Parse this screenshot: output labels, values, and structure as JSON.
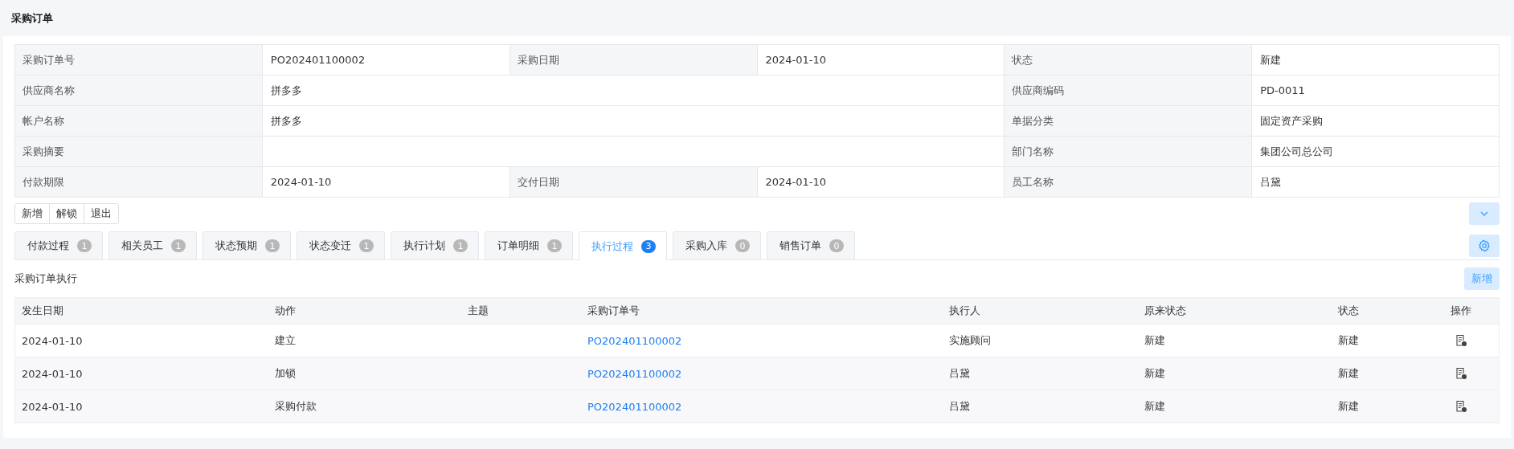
{
  "title": "采购订单",
  "info": {
    "rows": [
      {
        "kind": "triple",
        "cells": [
          {
            "label": "采购订单号",
            "value": "PO202401100002"
          },
          {
            "label": "采购日期",
            "value": "2024-01-10"
          },
          {
            "label": "状态",
            "value": "新建"
          }
        ]
      },
      {
        "kind": "double",
        "cells": [
          {
            "label": "供应商名称",
            "value": "拼多多"
          },
          {
            "label": "供应商编码",
            "value": "PD-0011"
          }
        ]
      },
      {
        "kind": "double",
        "cells": [
          {
            "label": "帐户名称",
            "value": "拼多多"
          },
          {
            "label": "单据分类",
            "value": "固定资产采购"
          }
        ]
      },
      {
        "kind": "double",
        "cells": [
          {
            "label": "采购摘要"
          },
          {
            "label": "部门名称",
            "value": "集团公司总公司"
          }
        ]
      },
      {
        "kind": "triple",
        "cells": [
          {
            "label": "付款期限",
            "value": "2024-01-10"
          },
          {
            "label": "交付日期",
            "value": "2024-01-10"
          },
          {
            "label": "员工名称",
            "value": "吕黛"
          }
        ]
      }
    ]
  },
  "actions": [
    "新增",
    "解锁",
    "退出"
  ],
  "tabs": [
    {
      "label": "付款过程",
      "count": "1",
      "selected": false
    },
    {
      "label": "相关员工",
      "count": "1",
      "selected": false
    },
    {
      "label": "状态预期",
      "count": "1",
      "selected": false
    },
    {
      "label": "状态变迁",
      "count": "1",
      "selected": false
    },
    {
      "label": "执行计划",
      "count": "1",
      "selected": false
    },
    {
      "label": "订单明细",
      "count": "1",
      "selected": false
    },
    {
      "label": "执行过程",
      "count": "3",
      "selected": true
    },
    {
      "label": "采购入库",
      "count": "0",
      "selected": false
    },
    {
      "label": "销售订单",
      "count": "0",
      "selected": false
    }
  ],
  "section": {
    "title": "采购订单执行",
    "add_button": "新增"
  },
  "table": {
    "columns": [
      {
        "label": "发生日期",
        "kind": "text"
      },
      {
        "label": "动作",
        "kind": "text"
      },
      {
        "label": "主题",
        "kind": "text"
      },
      {
        "label": "采购订单号",
        "kind": "link"
      },
      {
        "label": "执行人",
        "kind": "text"
      },
      {
        "label": "原来状态",
        "kind": "text"
      },
      {
        "label": "状态",
        "kind": "text"
      },
      {
        "label": "操作",
        "kind": "action"
      }
    ],
    "rows": [
      {
        "cells": [
          "2024-01-10",
          "建立",
          "",
          "PO202401100002",
          "实施顾问",
          "新建",
          "新建",
          ""
        ]
      },
      {
        "cells": [
          "2024-01-10",
          "加锁",
          "",
          "PO202401100002",
          "吕黛",
          "新建",
          "新建",
          ""
        ]
      },
      {
        "cells": [
          "2024-01-10",
          "采购付款",
          "",
          "PO202401100002",
          "吕黛",
          "新建",
          "新建",
          ""
        ]
      }
    ]
  }
}
